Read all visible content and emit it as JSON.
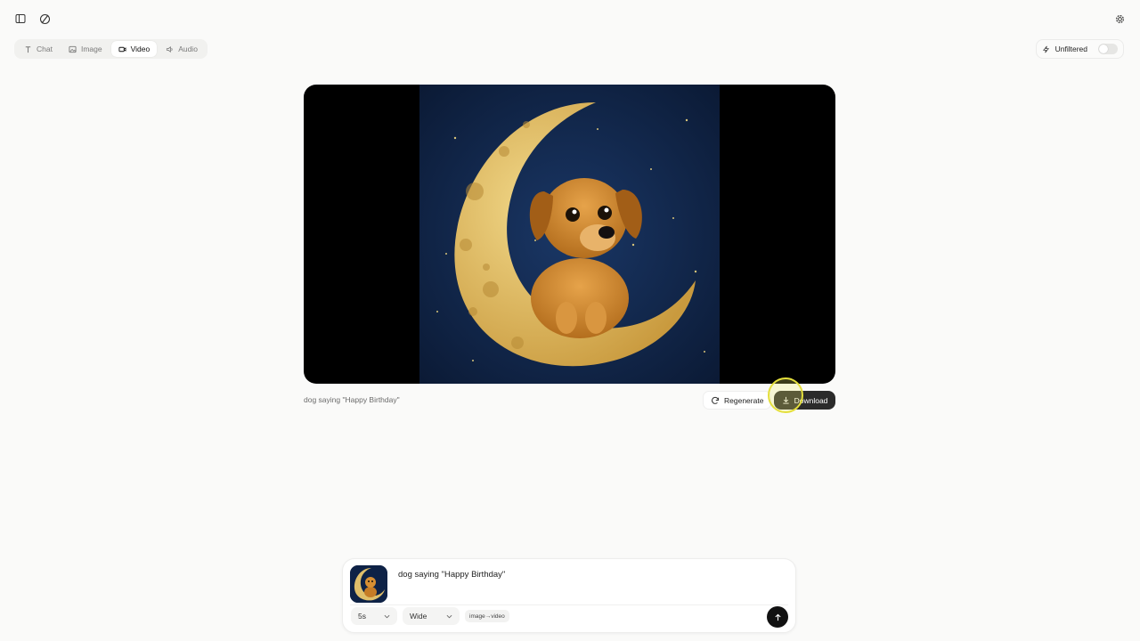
{
  "topbar": {
    "sidebar_icon": "sidebar-toggle-icon",
    "logo_icon": "app-logo-icon",
    "settings_icon": "gear-icon"
  },
  "mode_tabs": [
    {
      "label": "Chat",
      "icon": "text-icon",
      "active": false
    },
    {
      "label": "Image",
      "icon": "image-icon",
      "active": false
    },
    {
      "label": "Video",
      "icon": "video-camera-icon",
      "active": true
    },
    {
      "label": "Audio",
      "icon": "speaker-icon",
      "active": false
    }
  ],
  "unfiltered": {
    "label": "Unfiltered",
    "enabled": false
  },
  "result": {
    "caption": "dog saying \"Happy Birthday\"",
    "regenerate_label": "Regenerate",
    "download_label": "Download"
  },
  "composer": {
    "prompt": "dog saying \"Happy Birthday\"",
    "duration": "5s",
    "aspect": "Wide",
    "mode_chip": "image→video"
  },
  "colors": {
    "accent_dark": "#2b2b2b",
    "page_bg": "#fafaf9",
    "highlight": "#e4df3b"
  }
}
